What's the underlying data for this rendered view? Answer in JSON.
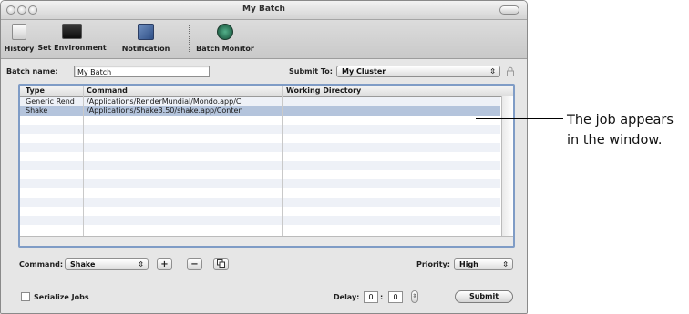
{
  "window": {
    "title": "My Batch"
  },
  "toolbar": {
    "items": [
      {
        "label": "History",
        "icon": "history-icon"
      },
      {
        "label": "Set Environment",
        "icon": "terminal-icon"
      },
      {
        "label": "Notification",
        "icon": "notification-icon"
      },
      {
        "label": "Batch Monitor",
        "icon": "batch-monitor-icon"
      }
    ]
  },
  "batch": {
    "name_label": "Batch name:",
    "name_value": "My Batch",
    "submit_to_label": "Submit To:",
    "submit_to_value": "My Cluster"
  },
  "table": {
    "columns": [
      "Type",
      "Command",
      "Working Directory"
    ],
    "rows": [
      {
        "type": "Generic Rend",
        "command": "/Applications/RenderMundial/Mondo.app/C",
        "working_directory": ""
      },
      {
        "type": "Shake",
        "command": "/Applications/Shake3.50/shake.app/Conten",
        "working_directory": ""
      }
    ],
    "selected_row": 1
  },
  "bottom": {
    "command_label": "Command:",
    "command_value": "Shake",
    "add_label": "+",
    "remove_label": "−",
    "priority_label": "Priority:",
    "priority_value": "High",
    "serialize_label": "Serialize Jobs",
    "delay_label": "Delay:",
    "delay_minutes": "0",
    "delay_separator": ":",
    "delay_seconds": "0",
    "submit_label": "Submit"
  },
  "callout": {
    "text": "The job appears in the window."
  },
  "colors": {
    "selection": "#b4c4dc",
    "table_frame": "#7f9cc6"
  }
}
